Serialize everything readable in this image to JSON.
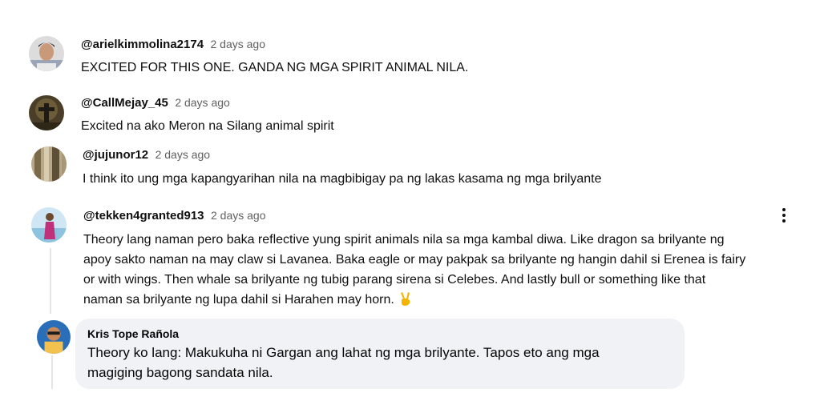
{
  "comments": [
    {
      "handle": "@arielkimmolina2174",
      "time": "2 days ago",
      "text": "EXCITED FOR THIS ONE. GANDA NG MGA SPIRIT ANIMAL NILA."
    },
    {
      "handle": "@CallMejay_45",
      "time": "2 days ago",
      "text": "Excited na ako Meron na Silang animal spirit"
    },
    {
      "handle": "@jujunor12",
      "time": "2 days ago",
      "text": "I think ito ung mga kapangyarihan nila na magbibigay pa ng lakas kasama ng mga brilyante"
    },
    {
      "handle": "@tekken4granted913",
      "time": "2 days ago",
      "lines": [
        "Theory lang naman pero baka reflective yung spirit animals nila sa mga kambal diwa. Like dragon sa brilyante ng",
        "apoy sakto naman na may claw si Lavanea. Baka eagle or may pakpak sa brilyante ng hangin dahil si Erenea is fairy",
        "or with wings. Then whale sa brilyante ng tubig parang sirena si Celebes. And lastly bull or something like that",
        "naman sa brilyante ng lupa dahil si Harahen may horn."
      ],
      "emoji": "victory-hand-icon"
    }
  ],
  "reply": {
    "name": "Kris Tope Rañola",
    "lines": [
      "Theory ko lang: Makukuha ni Gargan ang lahat ng mga brilyante. Tapos eto ang mga",
      "magiging bagong sandata nila."
    ]
  },
  "menu_icon": "more-vertical-icon",
  "colors": {
    "text": "#0f0f0f",
    "secondary": "#606060",
    "reply_bg": "#f0f2f5"
  }
}
